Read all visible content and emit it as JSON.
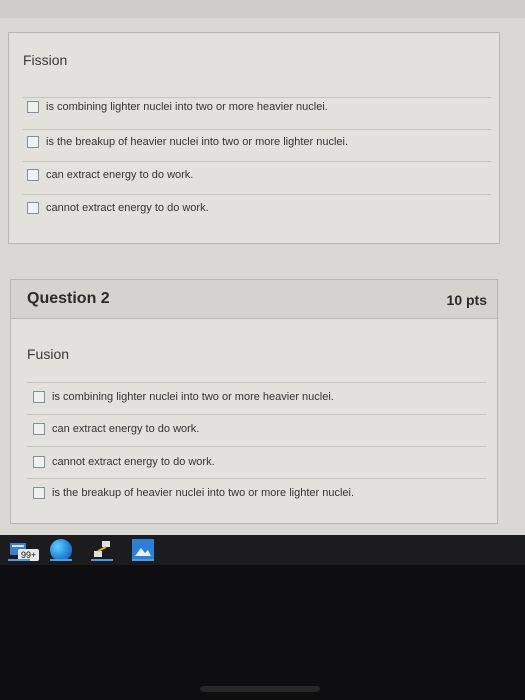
{
  "question1": {
    "prompt": "Fission",
    "options": [
      "is combining lighter nuclei into two or more heavier nuclei.",
      "is the breakup of heavier nuclei into two or more lighter nuclei.",
      "can extract energy to do work.",
      "cannot extract energy to do work."
    ]
  },
  "question2": {
    "title": "Question 2",
    "points": "10 pts",
    "prompt": "Fusion",
    "options": [
      "is combining lighter nuclei into two or more heavier nuclei.",
      "can extract energy to do work.",
      "cannot extract energy to do work.",
      "is the breakup of heavier nuclei into two or more lighter nuclei."
    ]
  },
  "taskbar": {
    "badge": "99+",
    "icons": [
      "tasks-icon",
      "edge-browser-icon",
      "network-icon",
      "photos-icon"
    ]
  },
  "colors": {
    "page_bg": "#d9d8d3",
    "card_bg": "#e2e1dc",
    "taskbar_bg": "#1c1c1f",
    "checkbox_border": "#7e8fa6"
  }
}
